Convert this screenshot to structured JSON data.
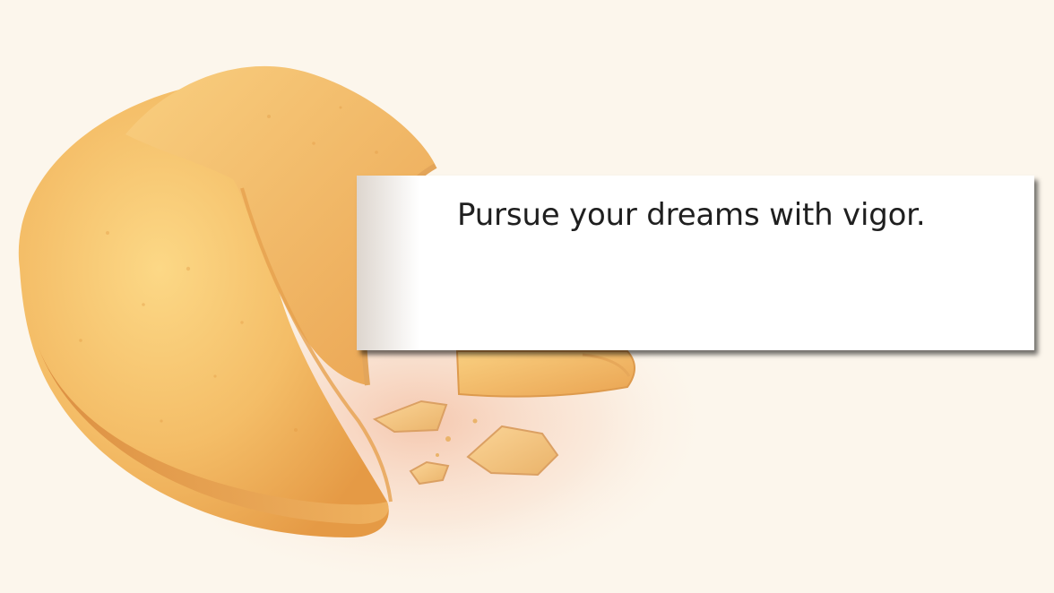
{
  "fortune": {
    "message": "Pursue your dreams with vigor."
  },
  "scene": {
    "background_color": "#fcf6ec",
    "cookie_color": "#f2b55a",
    "paper_color": "#ffffff",
    "illustration": "fortune-cookie-icon"
  }
}
